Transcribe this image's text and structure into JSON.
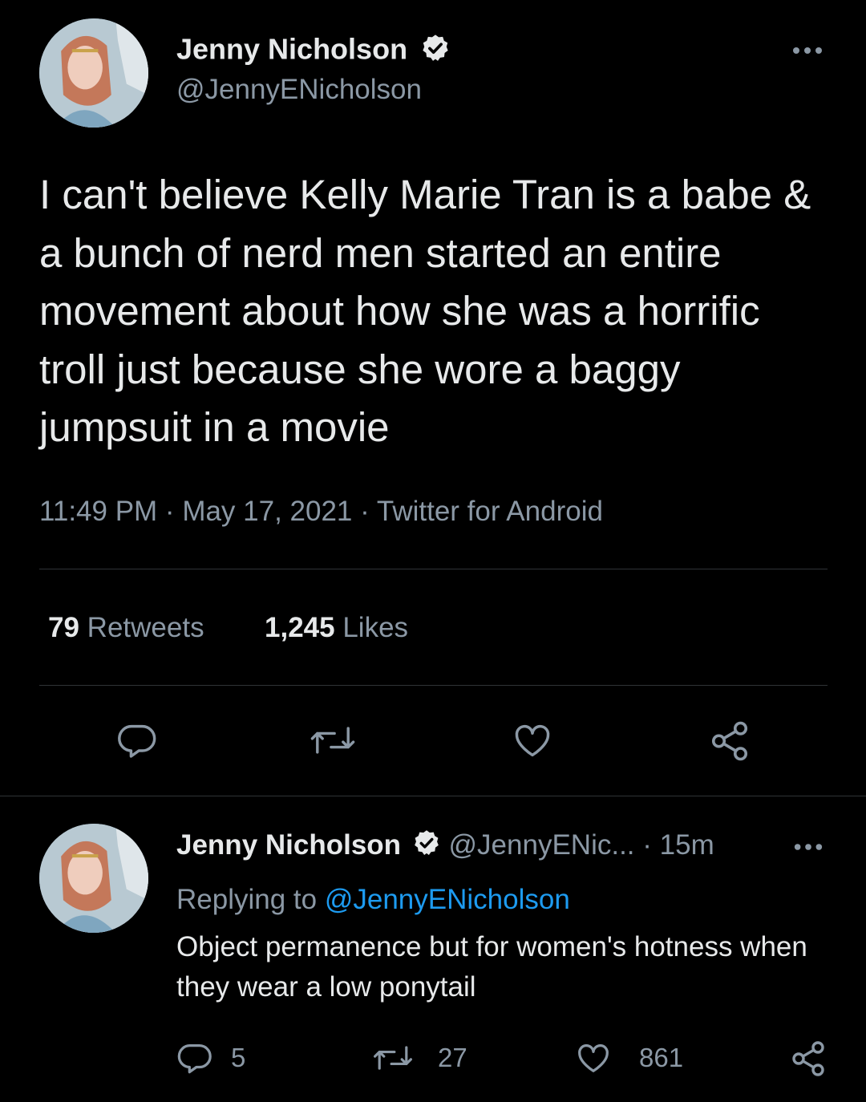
{
  "main_tweet": {
    "author_name": "Jenny Nicholson",
    "author_handle": "@JennyENicholson",
    "text": "I can't believe Kelly Marie Tran is a babe & a bunch of nerd men started an entire movement about how she was a horrific troll just because she wore a baggy jumpsuit in a movie",
    "meta": "11:49 PM · May 17, 2021 · Twitter for Android",
    "retweets_count": "79",
    "retweets_label": "Retweets",
    "likes_count": "1,245",
    "likes_label": "Likes",
    "icons": [
      "more-icon",
      "verified-icon",
      "reply-icon",
      "retweet-icon",
      "like-icon",
      "share-icon"
    ]
  },
  "reply_tweet": {
    "author_name": "Jenny Nicholson",
    "author_handle": "@JennyENic...",
    "separator": "·",
    "time": "15m",
    "replying_prefix": "Replying to",
    "replying_handle": "@JennyENicholson",
    "text": "Object permanence but for women's hotness when they wear a low ponytail",
    "reply_count": "5",
    "retweet_count": "27",
    "like_count": "861"
  },
  "colors": {
    "background": "#000000",
    "text": "#e7e9ea",
    "secondary": "#8b98a5",
    "link": "#1d9bf0",
    "divider": "#2f3336"
  }
}
